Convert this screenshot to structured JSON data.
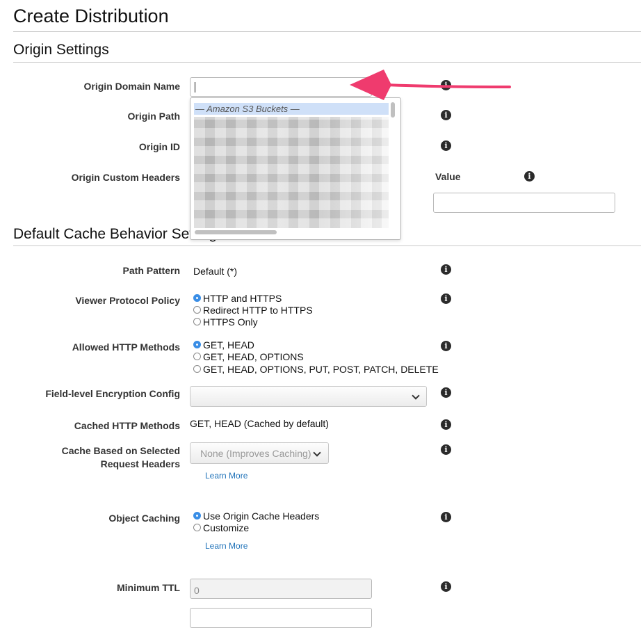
{
  "page_title": "Create Distribution",
  "origin_settings": {
    "title": "Origin Settings",
    "origin_domain_name_label": "Origin Domain Name",
    "origin_domain_name_value": "",
    "origin_path_label": "Origin Path",
    "origin_id_label": "Origin ID",
    "origin_custom_headers_label": "Origin Custom Headers",
    "value_label": "Value",
    "dropdown_group_header": "— Amazon S3 Buckets —"
  },
  "cache_behavior": {
    "title": "Default Cache Behavior Settings",
    "path_pattern_label": "Path Pattern",
    "path_pattern_value": "Default (*)",
    "viewer_protocol_label": "Viewer Protocol Policy",
    "viewer_protocol_options": [
      "HTTP and HTTPS",
      "Redirect HTTP to HTTPS",
      "HTTPS Only"
    ],
    "viewer_protocol_selected": "HTTP and HTTPS",
    "allowed_methods_label": "Allowed HTTP Methods",
    "allowed_methods_options": [
      "GET, HEAD",
      "GET, HEAD, OPTIONS",
      "GET, HEAD, OPTIONS, PUT, POST, PATCH, DELETE"
    ],
    "allowed_methods_selected": "GET, HEAD",
    "field_level_label": "Field-level Encryption Config",
    "field_level_value": "",
    "cached_methods_label": "Cached HTTP Methods",
    "cached_methods_value": "GET, HEAD (Cached by default)",
    "cache_headers_label_line1": "Cache Based on Selected",
    "cache_headers_label_line2": "Request Headers",
    "cache_headers_value": "None (Improves Caching)",
    "learn_more": "Learn More",
    "object_caching_label": "Object Caching",
    "object_caching_options": [
      "Use Origin Cache Headers",
      "Customize"
    ],
    "object_caching_selected": "Use Origin Cache Headers",
    "minimum_ttl_label": "Minimum TTL",
    "minimum_ttl_value": "0"
  },
  "icons": {
    "info": "info-icon",
    "dropdown": "chevron-down-icon",
    "annotation": "arrow-annotation"
  },
  "colors": {
    "annotation_arrow": "#ef3b6e",
    "radio_selected": "#3a8ee6",
    "link": "#2073b9",
    "dropdown_highlight": "#cfe0f8"
  }
}
